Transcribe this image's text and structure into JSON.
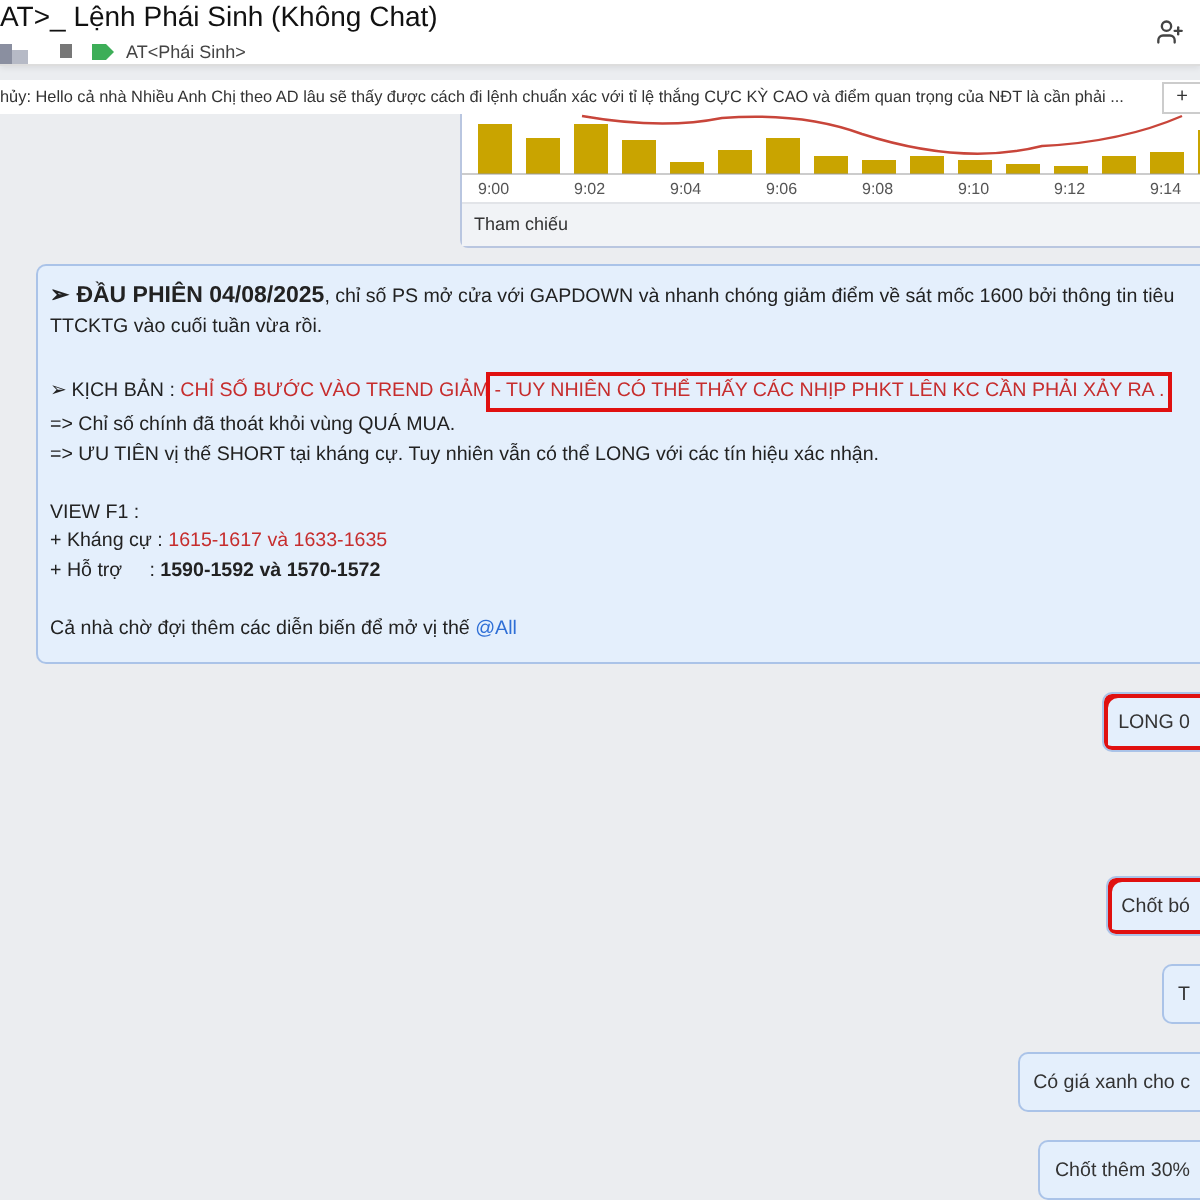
{
  "header": {
    "title": "AT>_ Lệnh Phái Sinh (Không Chat)",
    "tag": "AT<Phái Sinh>"
  },
  "pinned": {
    "text": "hủy: Hello cả nhà Nhiều Anh Chị theo AD lâu sẽ thấy được cách đi lệnh chuẩn xác với tỉ lệ thắng CỰC KỲ CAO và điểm quan trọng của NĐT là cần phải ...",
    "button": "+"
  },
  "chart_image": {
    "time_labels": [
      "9:00",
      "9:02",
      "9:04",
      "9:06",
      "9:08",
      "9:10",
      "9:12",
      "9:14"
    ],
    "footer": "Tham chiếu"
  },
  "message": {
    "lines": [
      {
        "segments": [
          {
            "kind": "heading",
            "text": "➢ ĐẦU PHIÊN 04/08/2025"
          },
          {
            "kind": "plain",
            "text": ", chỉ số PS mở cửa với GAPDOWN và nhanh chóng giảm điểm về sát mốc 1600 bởi thông tin tiêu"
          }
        ]
      },
      {
        "segments": [
          {
            "kind": "plain",
            "text": "TTCKTG vào cuối tuần vừa rồi."
          }
        ]
      },
      {
        "kind": "blank"
      },
      {
        "segments": [
          {
            "kind": "plain",
            "text": "➢ KỊCH BẢN : "
          },
          {
            "kind": "red",
            "text": "CHỈ SỐ BƯỚC VÀO TREND GIẢM "
          },
          {
            "kind": "red",
            "text": "- TUY NHIÊN CÓ THỂ THẤY CÁC NHỊP PHKT LÊN KC CẦN PHẢI XẢY RA .",
            "highlighted": true
          }
        ]
      },
      {
        "segments": [
          {
            "kind": "plain",
            "text": "=> Chỉ số chính đã thoát khỏi vùng QUÁ MUA."
          }
        ]
      },
      {
        "segments": [
          {
            "kind": "plain",
            "text": "=> ƯU TIÊN vị thế SHORT tại kháng cự. Tuy nhiên vẫn có thể LONG với các tín hiệu xác nhận."
          }
        ]
      },
      {
        "kind": "blank"
      },
      {
        "segments": [
          {
            "kind": "plain",
            "text": "VIEW F1 :"
          }
        ]
      },
      {
        "segments": [
          {
            "kind": "plain",
            "text": "+ Kháng cự : "
          },
          {
            "kind": "red",
            "text": "1615-1617 và 1633-1635"
          }
        ]
      },
      {
        "segments": [
          {
            "kind": "plain",
            "text": "+ Hỗ trợ     : "
          },
          {
            "kind": "bold",
            "text": "1590-1592 và 1570-1572"
          }
        ]
      },
      {
        "kind": "blank"
      },
      {
        "segments": [
          {
            "kind": "plain",
            "text": "Cả nhà chờ đợi thêm các diễn biến để mở vị thế "
          },
          {
            "kind": "link",
            "text": "@All"
          }
        ]
      }
    ]
  },
  "replies": [
    {
      "text": "LONG 0",
      "highlighted": true
    },
    {
      "text": "Chốt bó",
      "highlighted": true
    },
    {
      "text": "T",
      "highlighted": false
    },
    {
      "text": "Có giá xanh cho c",
      "highlighted": false
    },
    {
      "text": "Chốt thêm 30%",
      "highlighted": false
    }
  ]
}
